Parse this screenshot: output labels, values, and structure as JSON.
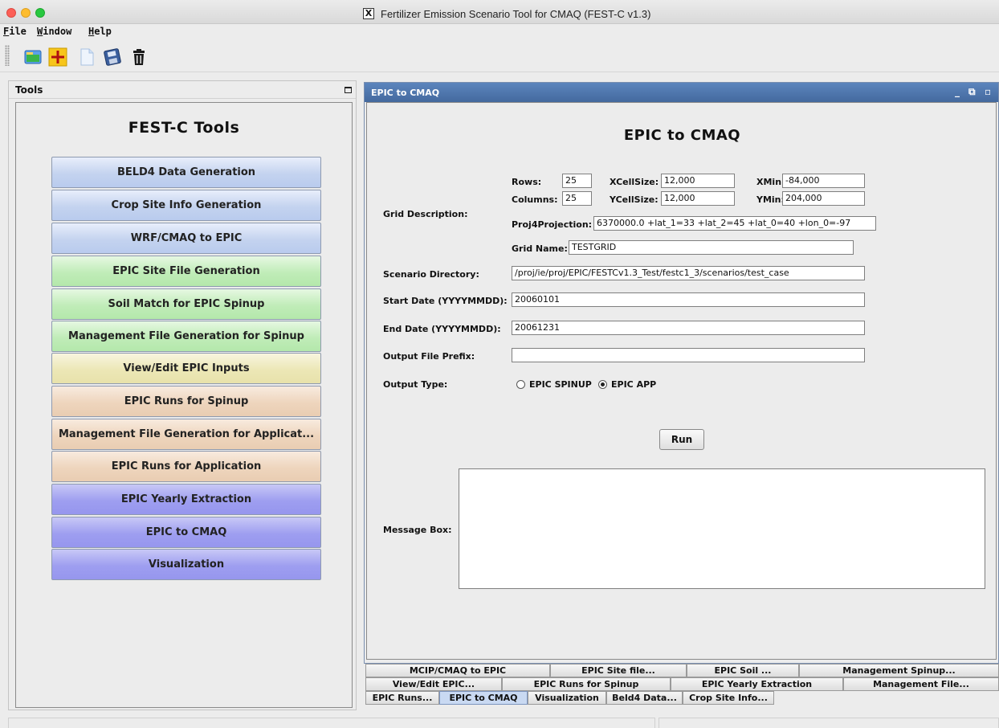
{
  "window": {
    "title": "Fertilizer Emission Scenario Tool for CMAQ (FEST-C v1.3)",
    "x_logo": "X"
  },
  "menu": [
    "File",
    "Window",
    "Help"
  ],
  "toolbar": {
    "buttons": [
      {
        "icon": "open-folder-icon"
      },
      {
        "icon": "add-icon"
      },
      {
        "icon": "new-file-icon"
      },
      {
        "icon": "save-icon"
      },
      {
        "icon": "trash-icon"
      }
    ]
  },
  "tools_panel": {
    "title": "Tools",
    "heading": "FEST-C Tools",
    "buttons": [
      {
        "label": "BELD4 Data Generation",
        "color": "#c4d3ef"
      },
      {
        "label": "Crop Site Info Generation",
        "color": "#c4d3ef"
      },
      {
        "label": "WRF/CMAQ to EPIC",
        "color": "#c4d3ef"
      },
      {
        "label": "EPIC Site File Generation",
        "color": "#c0ecb8"
      },
      {
        "label": "Soil Match for EPIC Spinup",
        "color": "#c0ecb8"
      },
      {
        "label": "Management File Generation for Spinup",
        "color": "#c0ecb8"
      },
      {
        "label": "View/Edit EPIC Inputs",
        "color": "#ece7b6"
      },
      {
        "label": "EPIC Runs for Spinup",
        "color": "#eed5bd"
      },
      {
        "label": "Management File Generation for Applicat...",
        "color": "#eed5bd"
      },
      {
        "label": "EPIC Runs for Application",
        "color": "#eed5bd"
      },
      {
        "label": "EPIC Yearly Extraction",
        "color": "#9e9ef0"
      },
      {
        "label": "EPIC to CMAQ",
        "color": "#9e9ef0"
      },
      {
        "label": "Visualization",
        "color": "#9e9ef0"
      }
    ]
  },
  "frame": {
    "title": "EPIC to CMAQ",
    "controls": {
      "minimize": "_",
      "restore": "⧉",
      "maximize": "▫"
    },
    "heading": "EPIC to CMAQ",
    "grid": {
      "section_label": "Grid Description:",
      "rows_label": "Rows:",
      "rows": "25",
      "xcellsize_label": "XCellSize:",
      "xcellsize": "12,000",
      "xmin_label": "XMin:",
      "xmin": "-84,000",
      "columns_label": "Columns:",
      "columns": "25",
      "ycellsize_label": "YCellSize:",
      "ycellsize": "12,000",
      "ymin_label": "YMin:",
      "ymin": "204,000",
      "proj_label": "Proj4Projection:",
      "proj": "6370000.0 +lat_1=33 +lat_2=45 +lat_0=40 +lon_0=-97",
      "grid_name_label": "Grid Name:",
      "grid_name": "TESTGRID"
    },
    "scenario_dir_label": "Scenario Directory:",
    "scenario_dir": "/proj/ie/proj/EPIC/FESTCv1.3_Test/festc1_3/scenarios/test_case",
    "start_date_label": "Start Date (YYYYMMDD):",
    "start_date": "20060101",
    "end_date_label": "End Date (YYYYMMDD):",
    "end_date": "20061231",
    "prefix_label": "Output File Prefix:",
    "prefix": "",
    "output_type_label": "Output Type:",
    "options": [
      {
        "label": "EPIC SPINUP",
        "selected": false
      },
      {
        "label": "EPIC APP",
        "selected": true
      }
    ],
    "run_label": "Run",
    "message_label": "Message Box:"
  },
  "tabs": {
    "row1": [
      "MCIP/CMAQ to EPIC",
      "EPIC Site file...",
      "EPIC Soil ...",
      "Management Spinup..."
    ],
    "row2": [
      "View/Edit EPIC...",
      "EPIC Runs for Spinup",
      "EPIC Yearly Extraction",
      "Management File..."
    ],
    "row3": [
      "EPIC Runs...",
      "EPIC to CMAQ",
      "Visualization",
      "Beld4 Data...",
      "Crop Site Info..."
    ],
    "active": "EPIC to CMAQ"
  }
}
